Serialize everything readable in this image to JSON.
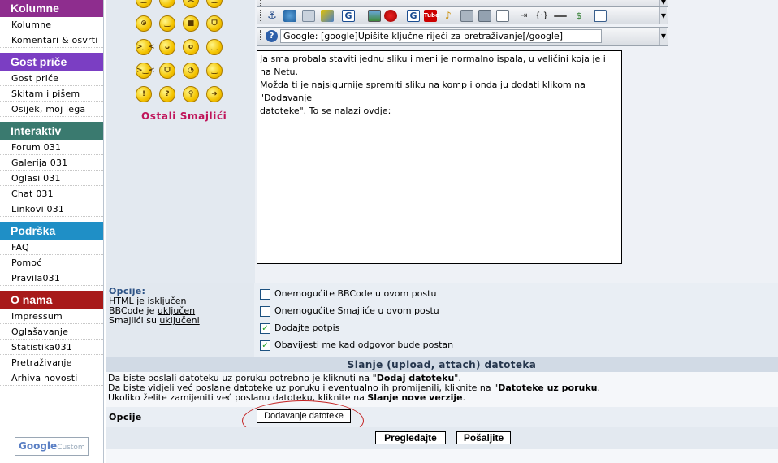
{
  "sidebar": {
    "sections": [
      {
        "title": "Kolumne",
        "color": "#8e2d8e",
        "items": [
          "Kolumne",
          "Komentari & osvrti"
        ]
      },
      {
        "title": "Gost priče",
        "color": "#7b3ec3",
        "items": [
          "Gost priče",
          "Skitam i pišem",
          "Osijek, moj lega"
        ]
      },
      {
        "title": "Interaktiv",
        "color": "#3a7a6f",
        "items": [
          "Forum 031",
          "Galerija 031",
          "Oglasi 031",
          "Chat 031",
          "Linkovi 031"
        ]
      },
      {
        "title": "Podrška",
        "color": "#1f8fc6",
        "items": [
          "FAQ",
          "Pomoć",
          "Pravila031"
        ]
      },
      {
        "title": "O nama",
        "color": "#a81a1a",
        "items": [
          "Impressum",
          "Oglašavanje",
          "Statistika031",
          "Pretraživanje",
          "Arhiva novosti"
        ]
      }
    ],
    "google_search": {
      "brand": "Google",
      "placeholder": "Custom S"
    }
  },
  "smilies": {
    "icons": [
      "smile-icon",
      "wink-icon",
      "sad-icon",
      "happy-icon",
      "confused-icon",
      "grin-icon",
      "cool-icon",
      "laugh-icon",
      "angry-icon",
      "tongue-icon",
      "surprised-icon",
      "neutral-icon",
      "evil-icon",
      "devil-icon",
      "rolleyes-icon",
      "smile2-icon",
      "exclaim-icon",
      "question-icon",
      "idea-icon",
      "arrow-icon"
    ],
    "more_link": "Ostali Smajlići"
  },
  "editor": {
    "google_field_value": "Google: [google]Upišite ključne riječi za pretraživanje[/google]",
    "message_lines": [
      "Ja sma probala staviti jednu sliku i meni je normalno ispala, u veličini koja je i na Netu.",
      "Možda ti je najsigurnije spremiti sliku na komp i onda ju dodati klikom na \"Dodavanje",
      "datoteke\". To se nalazi ovdje:"
    ]
  },
  "options": {
    "label": "Opcije:",
    "html_label": "HTML je",
    "html_state": "isključen",
    "bbcode_label": "BBCode je",
    "bbcode_state": "uključen",
    "smilies_label": "Smajlići su",
    "smilies_state": "uključeni",
    "checkboxes": [
      {
        "label": "Onemogućite BBCode u ovom postu",
        "checked": false
      },
      {
        "label": "Onemogućite Smajliće u ovom postu",
        "checked": false
      },
      {
        "label": "Dodajte potpis",
        "checked": true
      },
      {
        "label": "Obavijesti me kad odgovor bude postan",
        "checked": true
      }
    ]
  },
  "attachments": {
    "header": "Slanje (upload, attach) datoteka",
    "line1_pre": "Da biste poslali datoteku uz poruku potrebno je kliknuti na \"",
    "line1_bold": "Dodaj datoteku",
    "line1_post": "\".",
    "line2_pre": "Da biste vidjeli već poslane datoteke uz poruku i eventualno ih promijenili, kliknite na \"",
    "line2_bold": "Datoteke uz poruku",
    "line2_post": ".",
    "line3_pre": "Ukoliko želite zamijeniti već poslanu datoteku, kliknite na ",
    "line3_bold": "Slanje nove verzije",
    "line3_post": ".",
    "options_label": "Opcije",
    "add_file_button": "Dodavanje datoteke"
  },
  "actions": {
    "preview": "Pregledajte",
    "submit": "Pošaljite"
  }
}
